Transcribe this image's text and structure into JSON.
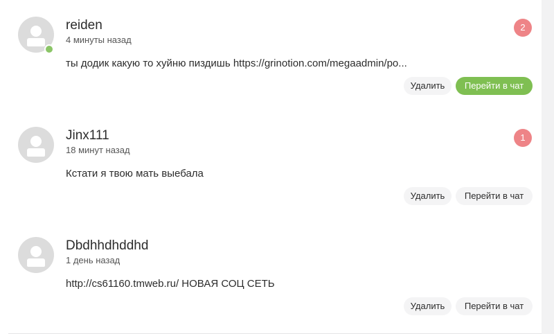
{
  "dialogs": [
    {
      "name": "reiden",
      "time": "4 минуты назад",
      "message": "ты додик какую то хуйню пиздишь https://grinotion.com/megaadmin/po...",
      "badge": "2",
      "online": true,
      "delete_label": "Удалить",
      "chat_label": "Перейти в чат",
      "chat_highlighted": true
    },
    {
      "name": "Jinx111",
      "time": "18 минут назад",
      "message": "Кстати я твою мать выебала",
      "badge": "1",
      "online": false,
      "delete_label": "Удалить",
      "chat_label": "Перейти в чат",
      "chat_highlighted": false
    },
    {
      "name": "Dbdhhdhddhd",
      "time": "1 день назад",
      "message": "http://cs61160.tmweb.ru/ НОВАЯ СОЦ СЕТЬ",
      "badge": "",
      "online": false,
      "delete_label": "Удалить",
      "chat_label": "Перейти в чат",
      "chat_highlighted": false
    }
  ],
  "colors": {
    "badge": "#ee8487",
    "online": "#8bc567",
    "primary_button": "#7fbf52"
  }
}
